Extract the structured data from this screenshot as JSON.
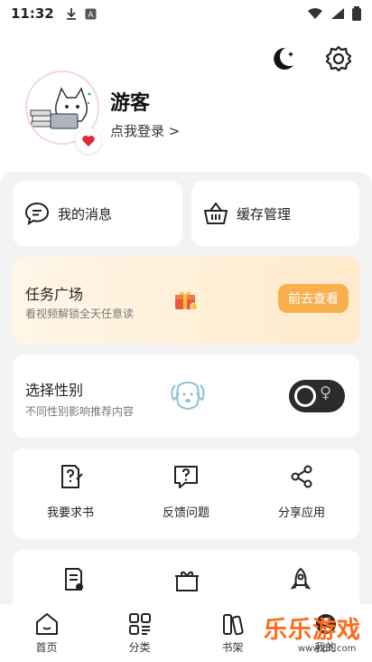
{
  "status_bar": {
    "time": "11:32"
  },
  "profile": {
    "username": "游客",
    "login_link": "点我登录 >"
  },
  "quick_cards": {
    "messages_label": "我的消息",
    "cache_label": "缓存管理"
  },
  "task": {
    "title": "任务广场",
    "subtitle": "看视频解锁全天任意读",
    "button": "前去查看"
  },
  "gender": {
    "title": "选择性别",
    "subtitle": "不同性别影响推荐内容"
  },
  "features": [
    {
      "label": "我要求书",
      "icon": "book-request-icon"
    },
    {
      "label": "反馈问题",
      "icon": "feedback-icon"
    },
    {
      "label": "分享应用",
      "icon": "share-icon"
    }
  ],
  "more_icons": [
    "document-add-icon",
    "gift-box-icon",
    "rocket-icon"
  ],
  "tabs": [
    {
      "label": "首页",
      "icon": "home-icon"
    },
    {
      "label": "分类",
      "icon": "category-icon"
    },
    {
      "label": "书架",
      "icon": "bookshelf-icon"
    },
    {
      "label": "我的",
      "icon": "profile-icon"
    }
  ],
  "watermark": {
    "text": "乐乐游戏",
    "site": "www.6lt.com"
  },
  "colors": {
    "accent": "#f8b04f",
    "panel_bg": "#f3f3f3",
    "heart": "#e0283c",
    "watermark": "#ff6a1a"
  }
}
